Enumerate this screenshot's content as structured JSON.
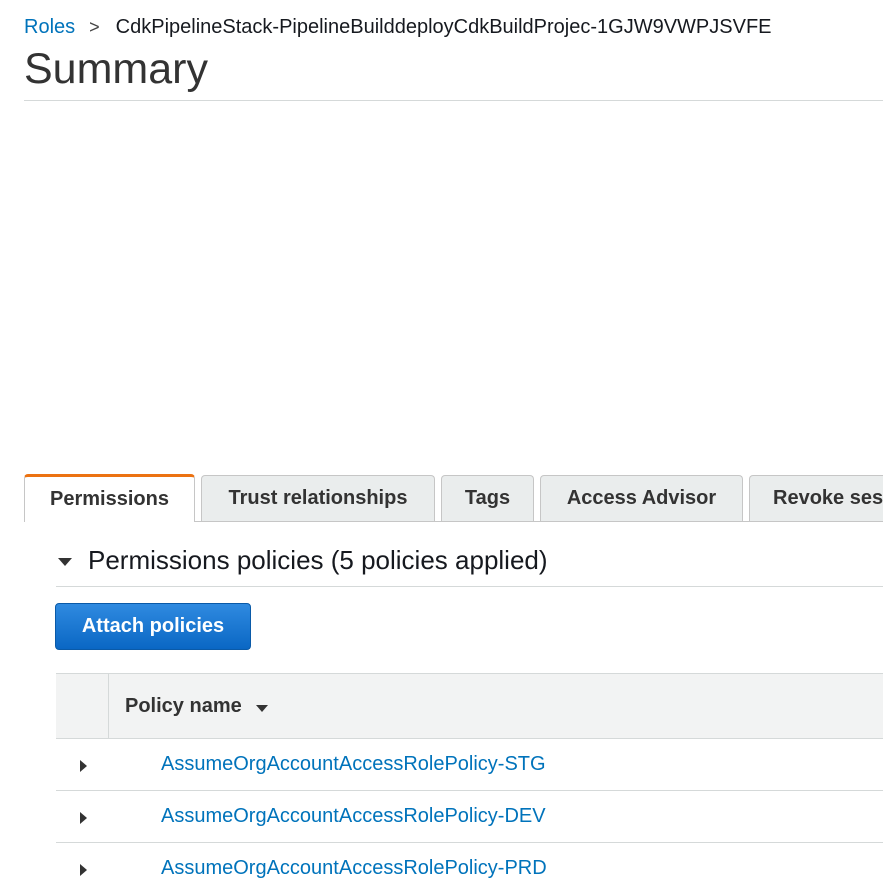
{
  "breadcrumb": {
    "parent": "Roles",
    "separator": ">",
    "current": "CdkPipelineStack-PipelineBuilddeployCdkBuildProjec-1GJW9VWPJSVFE"
  },
  "page_title": "Summary",
  "tabs": [
    {
      "label": "Permissions",
      "active": true
    },
    {
      "label": "Trust relationships",
      "active": false
    },
    {
      "label": "Tags",
      "active": false
    },
    {
      "label": "Access Advisor",
      "active": false
    },
    {
      "label": "Revoke sessions",
      "active": false
    }
  ],
  "permissions": {
    "section_title": "Permissions policies (5 policies applied)",
    "attach_button": "Attach policies",
    "table": {
      "column_header": "Policy name",
      "rows": [
        {
          "name": "AssumeOrgAccountAccessRolePolicy-STG"
        },
        {
          "name": "AssumeOrgAccountAccessRolePolicy-DEV"
        },
        {
          "name": "AssumeOrgAccountAccessRolePolicy-PRD"
        }
      ]
    }
  },
  "colors": {
    "link": "#0073bb",
    "active_tab_accent": "#ec7211",
    "primary_button": "#0a67c4"
  }
}
